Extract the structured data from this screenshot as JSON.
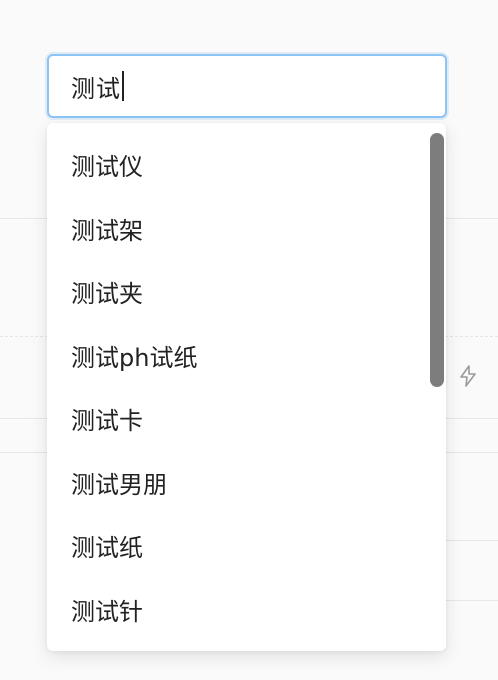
{
  "search": {
    "value": "测试"
  },
  "suggestions": [
    "测试仪",
    "测试架",
    "测试夹",
    "测试ph试纸",
    "测试卡",
    "测试男朋",
    "测试纸",
    "测试针"
  ],
  "icons": {
    "background_action": "lightning-icon"
  },
  "colors": {
    "focus_border": "#8ec4f4",
    "scrollbar": "#7d7d7d",
    "text": "#222222"
  }
}
